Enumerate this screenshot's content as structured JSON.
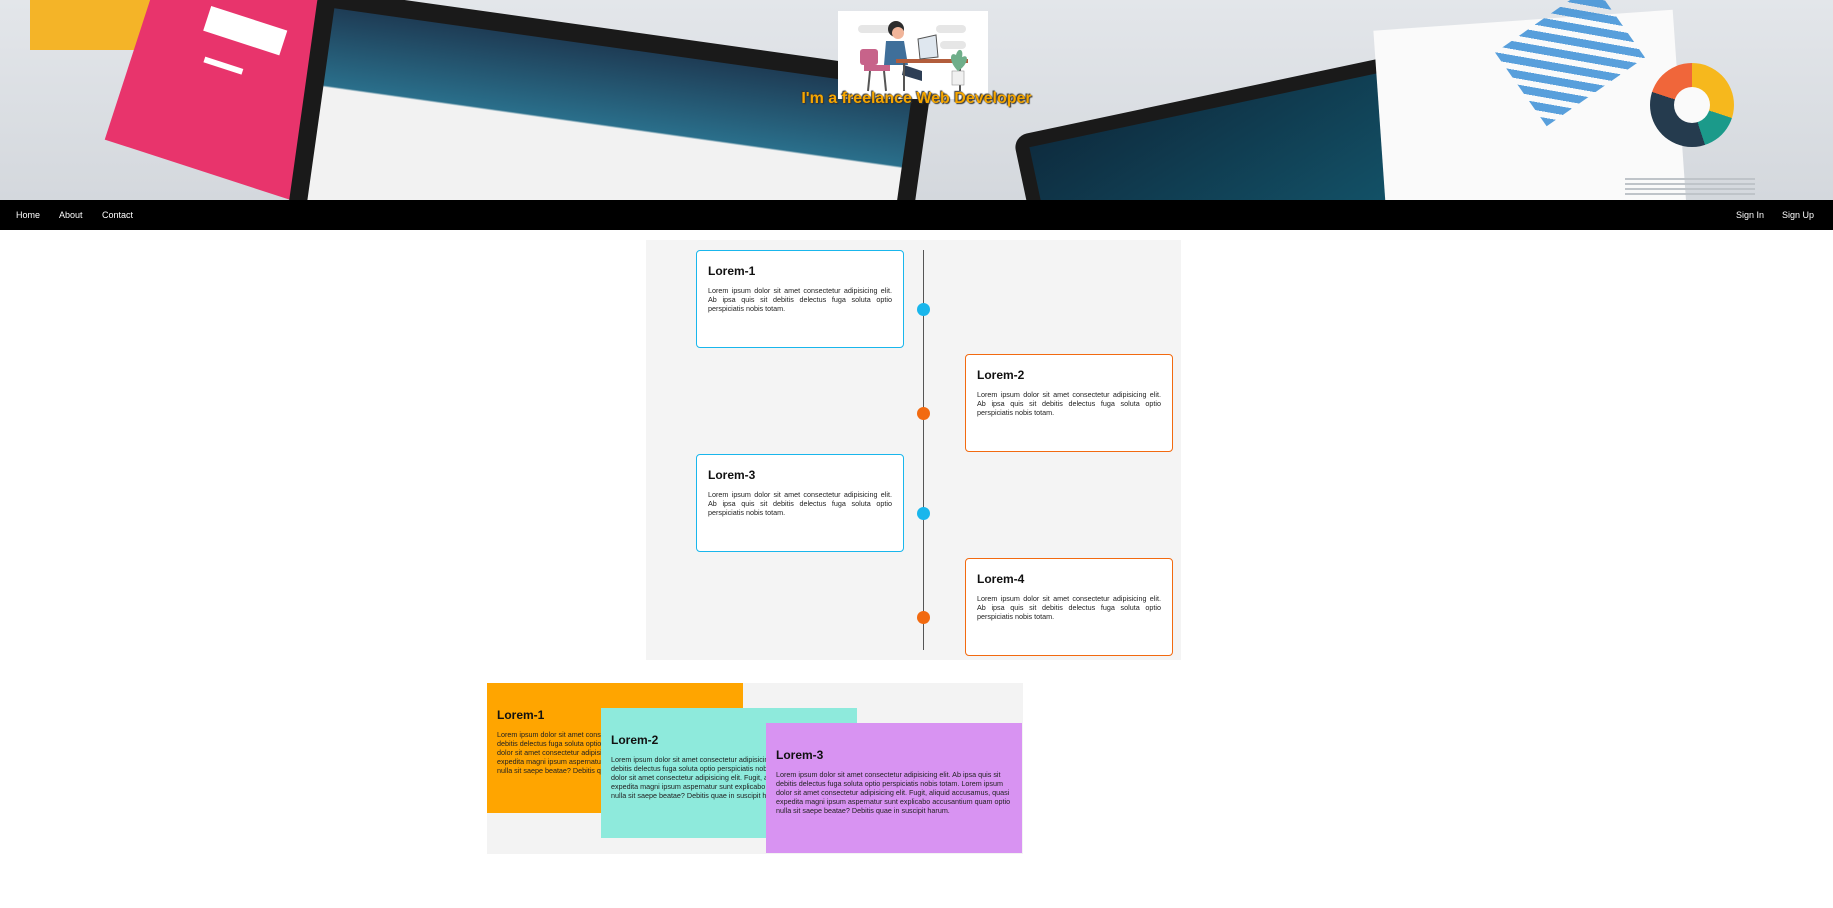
{
  "hero": {
    "title": "I'm a freelance Web Developer",
    "background": "desk-illustration"
  },
  "nav": {
    "left": [
      "Home",
      "About",
      "Contact"
    ],
    "right": [
      "Sign In",
      "Sign Up"
    ],
    "background": "#000000"
  },
  "timeline": {
    "items": [
      {
        "title": "Lorem-1",
        "text": "Lorem ipsum dolor sit amet consectetur adipisicing elit. Ab ipsa quis sit debitis delectus fuga soluta optio perspiciatis nobis totam.",
        "side": "left",
        "color": "#19b6ec"
      },
      {
        "title": "Lorem-2",
        "text": "Lorem ipsum dolor sit amet consectetur adipisicing elit. Ab ipsa quis sit debitis delectus fuga soluta optio perspiciatis nobis totam.",
        "side": "right",
        "color": "#f26a10"
      },
      {
        "title": "Lorem-3",
        "text": "Lorem ipsum dolor sit amet consectetur adipisicing elit. Ab ipsa quis sit debitis delectus fuga soluta optio perspiciatis nobis totam.",
        "side": "left",
        "color": "#19b6ec"
      },
      {
        "title": "Lorem-4",
        "text": "Lorem ipsum dolor sit amet consectetur adipisicing elit. Ab ipsa quis sit debitis delectus fuga soluta optio perspiciatis nobis totam.",
        "side": "right",
        "color": "#f26a10"
      }
    ]
  },
  "stack": {
    "items": [
      {
        "title": "Lorem-1",
        "text": "Lorem ipsum dolor sit amet consectetur adipisicing elit. Ab ipsa quis sit debitis delectus fuga soluta optio perspiciatis nobis totam. Lorem ipsum dolor sit amet consectetur adipisicing elit. Fugit, aliquid accusamus, quasi expedita magni ipsum aspernatur sunt explicabo accusantium quam optio nulla sit saepe beatae? Debitis quae in suscipit harum.",
        "color": "#ffa500"
      },
      {
        "title": "Lorem-2",
        "text": "Lorem ipsum dolor sit amet consectetur adipisicing elit. Ab ipsa quis sit debitis delectus fuga soluta optio perspiciatis nobis totam. Lorem ipsum dolor sit amet consectetur adipisicing elit. Fugit, aliquid accusamus, quasi expedita magni ipsum aspernatur sunt explicabo accusantium quam optio nulla sit saepe beatae? Debitis quae in suscipit harum.",
        "color": "#8eeadc"
      },
      {
        "title": "Lorem-3",
        "text": "Lorem ipsum dolor sit amet consectetur adipisicing elit. Ab ipsa quis sit debitis delectus fuga soluta optio perspiciatis nobis totam. Lorem ipsum dolor sit amet consectetur adipisicing elit. Fugit, aliquid accusamus, quasi expedita magni ipsum aspernatur sunt explicabo accusantium quam optio nulla sit saepe beatae? Debitis quae in suscipit harum.",
        "color": "#d893f2"
      }
    ]
  }
}
